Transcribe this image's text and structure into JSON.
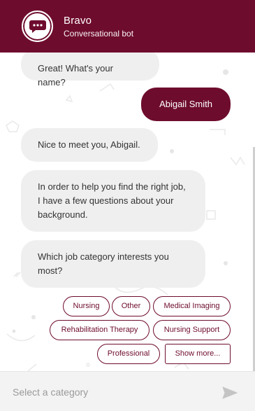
{
  "header": {
    "bot_name": "Bravo",
    "bot_subtitle": "Conversational bot",
    "avatar_icon": "chat-bubble-icon",
    "bg_color": "#6e0c2e"
  },
  "messages": [
    {
      "from": "bot",
      "text": "Great! What's your name?"
    },
    {
      "from": "user",
      "text": "Abigail Smith"
    },
    {
      "from": "bot",
      "text": "Nice to meet you, Abigail."
    },
    {
      "from": "bot",
      "lines": [
        "In order to help you find the right job,",
        "I have a few questions about your",
        "background."
      ]
    },
    {
      "from": "bot",
      "lines": [
        "Which job category interests you",
        "most?"
      ]
    }
  ],
  "options": [
    "Nursing",
    "Other",
    "Medical Imaging",
    "Rehabilitation Therapy",
    "Nursing Support",
    "Professional",
    "Show more..."
  ],
  "composer": {
    "placeholder": "Select a category",
    "send_icon": "send-icon"
  },
  "colors": {
    "accent": "#6e0c2e",
    "bot_bubble": "#efefef",
    "composer_bg": "#f3f3f3"
  }
}
